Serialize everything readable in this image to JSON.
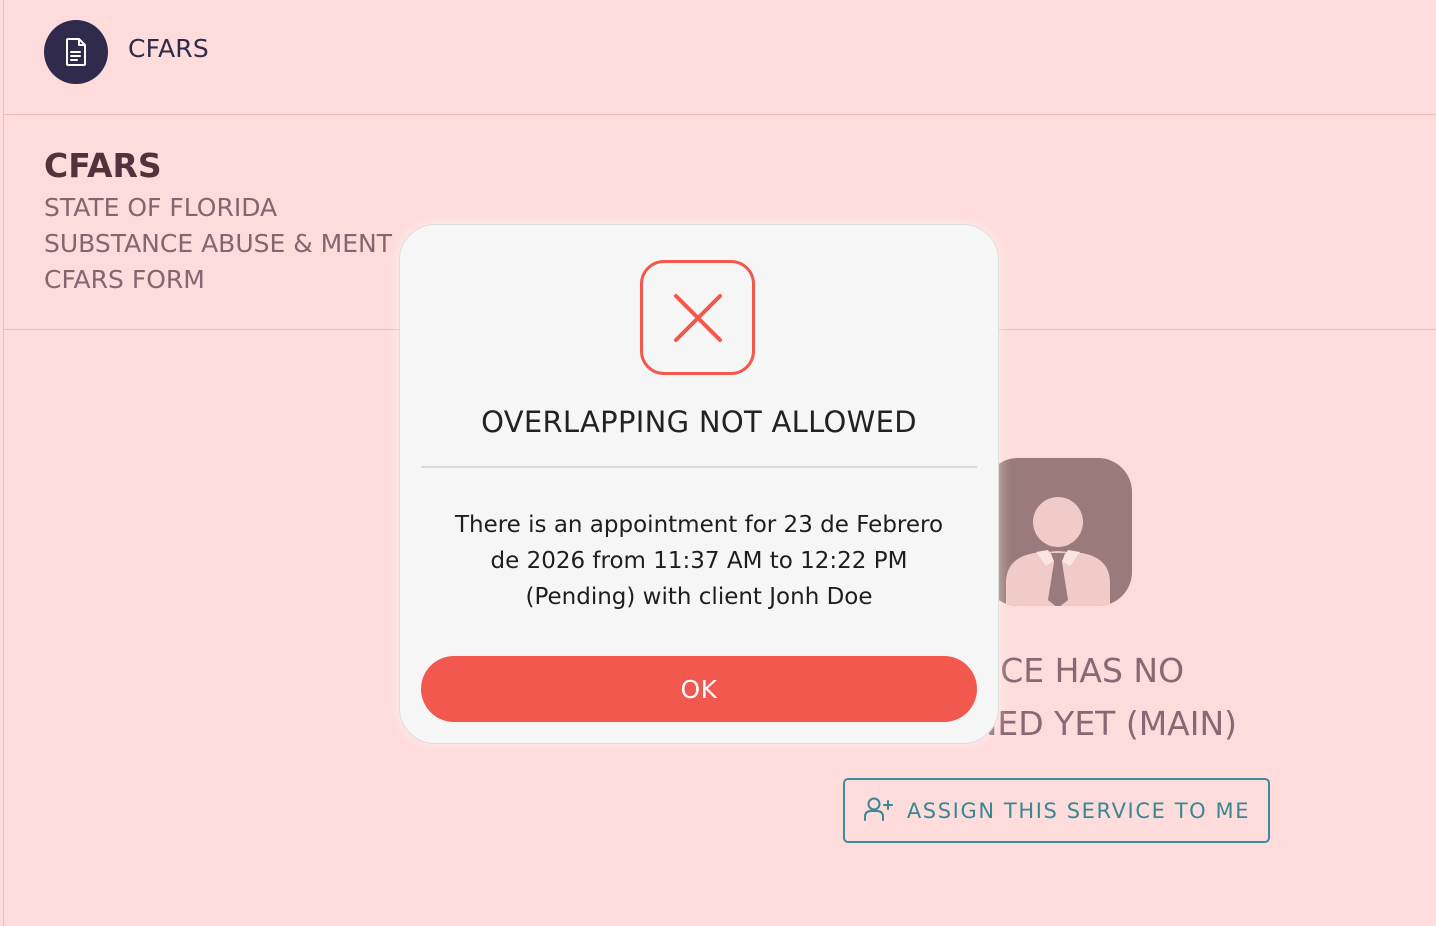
{
  "header": {
    "title": "CFARS",
    "icon": "document-icon"
  },
  "form": {
    "title": "CFARS",
    "lines": [
      "STATE OF FLORIDA",
      "SUBSTANCE ABUSE & MENT",
      "CFARS FORM"
    ]
  },
  "unassigned": {
    "avatar_icon": "user-tie-icon",
    "message_line1": "ERVICE HAS NO",
    "message_line2": "ASSIGNED YET (MAIN)",
    "assign_icon": "user-plus-icon",
    "assign_label": "ASSIGN THIS SERVICE TO ME"
  },
  "modal": {
    "icon": "close-x-icon",
    "title": "OVERLAPPING NOT ALLOWED",
    "message_line1": "There is an appointment for 23 de Febrero",
    "message_line2": "de 2026 from 11:37 AM to 12:22 PM",
    "message_line3": "(Pending) with client Jonh Doe",
    "ok_label": "OK"
  },
  "colors": {
    "page_background": "#FEDCDB",
    "header_icon_bg": "#302B4D",
    "modal_background": "#F6F6F6",
    "danger": "#F2584D",
    "teal_accent": "#3A8794",
    "avatar_bg": "#9A7A7A"
  }
}
